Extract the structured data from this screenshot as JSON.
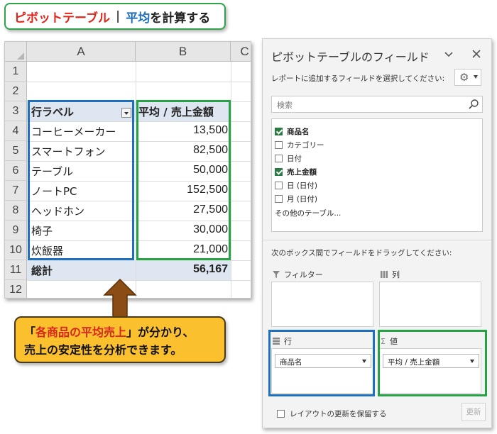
{
  "title": {
    "part1": "ピボットテーブル",
    "separator": "|",
    "part2": "平均",
    "part3": "を計算する"
  },
  "sheet": {
    "columns": [
      "A",
      "B",
      "C"
    ],
    "rows": [
      "1",
      "2",
      "3",
      "4",
      "5",
      "6",
      "7",
      "8",
      "9",
      "10",
      "11",
      "12"
    ],
    "header_label": "行ラベル",
    "header_value": "平均 / 売上金額",
    "items": [
      {
        "label": "コーヒーメーカー",
        "value": "13,500"
      },
      {
        "label": "スマートフォン",
        "value": "82,500"
      },
      {
        "label": "テーブル",
        "value": "50,000"
      },
      {
        "label": "ノートPC",
        "value": "152,500"
      },
      {
        "label": "ヘッドホン",
        "value": "27,500"
      },
      {
        "label": "椅子",
        "value": "30,000"
      },
      {
        "label": "炊飯器",
        "value": "21,000"
      }
    ],
    "total_label": "総計",
    "total_value": "56,167"
  },
  "callout": {
    "line1_prefix": "「",
    "line1_emph": "各商品の平均売上",
    "line1_suffix": "」が分かり、",
    "line2": "売上の安定性を分析できます。"
  },
  "pane": {
    "title": "ピボットテーブルのフィールド",
    "subtitle": "レポートに追加するフィールドを選択してください:",
    "search_placeholder": "検索",
    "fields": [
      {
        "label": "商品名",
        "checked": true
      },
      {
        "label": "カテゴリー",
        "checked": false
      },
      {
        "label": "日付",
        "checked": false
      },
      {
        "label": "売上金額",
        "checked": true
      },
      {
        "label": "日 (日付)",
        "checked": false
      },
      {
        "label": "月 (日付)",
        "checked": false
      }
    ],
    "more_tables": "その他のテーブル...",
    "drag_message": "次のボックス間でフィールドをドラッグしてください:",
    "areas": {
      "filter": "フィルター",
      "columns": "列",
      "rows": "行",
      "values": "値"
    },
    "rows_field": "商品名",
    "values_field": "平均 / 売上金額",
    "defer_label": "レイアウトの更新を保留する",
    "update_label": "更新"
  },
  "colors": {
    "accent_blue": "#1f6fbf",
    "accent_green": "#25a244",
    "title_red": "#e0261b",
    "callout_fill": "#fbc02d",
    "callout_emph": "#d9261c",
    "header_band": "#dde6f1"
  }
}
